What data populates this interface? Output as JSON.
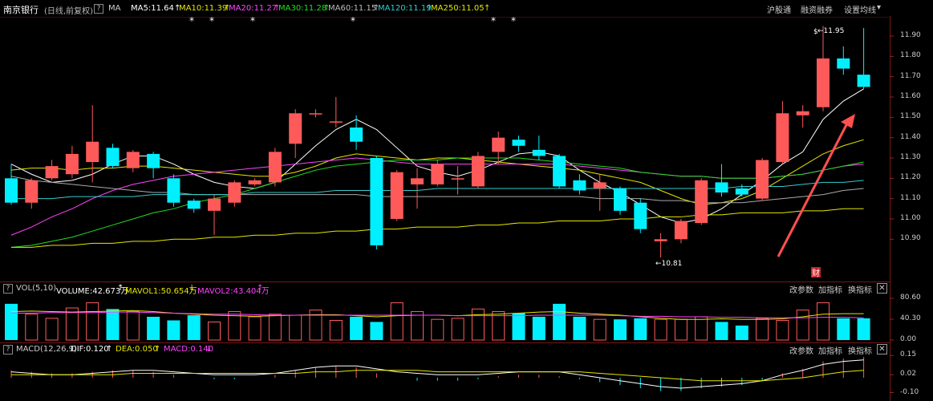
{
  "header": {
    "stock_name": "南京银行",
    "period": "(日线,前复权)",
    "help": "?",
    "indicator": "MA",
    "ma_items": [
      {
        "label": "MA5:11.64",
        "color": "#ffffff"
      },
      {
        "label": "MA10:11.39",
        "color": "#e6e600"
      },
      {
        "label": "MA20:11.27",
        "color": "#ff44ff"
      },
      {
        "label": "MA30:11.28",
        "color": "#22dd22"
      },
      {
        "label": "MA60:11.15",
        "color": "#bbbbbb"
      },
      {
        "label": "MA120:11.19",
        "color": "#33cccc"
      },
      {
        "label": "MA250:11.05",
        "color": "#e6e600"
      }
    ],
    "up_arrow": "↑",
    "menu": {
      "hgt": "沪股通",
      "margin": "融资融券",
      "settings": "设置均线",
      "settings_arrow": "▾"
    }
  },
  "price_axis": [
    "11.90",
    "11.80",
    "11.70",
    "11.60",
    "11.50",
    "11.40",
    "11.30",
    "11.20",
    "11.10",
    "11.00",
    "10.90"
  ],
  "annotations": {
    "high": "11.95",
    "low": "10.81",
    "fin_badge": "财",
    "marker": "*",
    "top_marker": "$"
  },
  "volume_panel": {
    "help": "?",
    "name": "VOL(5,10)",
    "volume": "VOLUME:42.673万",
    "mavol1": "MAVOL1:50.654万",
    "mavol2": "MAVOL2:43.404万",
    "arrow_up": "↑",
    "arrow_down": "↓",
    "change_params": "改参数",
    "add_indicator": "加指标",
    "switch_indicator": "换指标",
    "close": "✕",
    "axis": [
      "80.60",
      "40.30",
      "0.00"
    ]
  },
  "macd_panel": {
    "help": "?",
    "name": "MACD(12,26,9)",
    "dif": "DIF:0.120",
    "dea": "DEA:0.050",
    "macd": "MACD:0.140",
    "arrow_up": "↑",
    "arrow_down": "↓",
    "change_params": "改参数",
    "add_indicator": "加指标",
    "switch_indicator": "换指标",
    "close": "✕",
    "axis": [
      "0.15",
      "0.02",
      "-0.10"
    ]
  },
  "colors": {
    "up": "#ff5a5a",
    "down": "#00f0ff",
    "accent_arrow": "#ff5050"
  },
  "chart_data": {
    "type": "candlestick",
    "candles": [
      {
        "o": 11.2,
        "c": 11.08,
        "h": 11.27,
        "l": 11.07
      },
      {
        "o": 11.08,
        "c": 11.19,
        "h": 11.2,
        "l": 11.05
      },
      {
        "o": 11.2,
        "c": 11.26,
        "h": 11.29,
        "l": 11.19
      },
      {
        "o": 11.22,
        "c": 11.32,
        "h": 11.36,
        "l": 11.2
      },
      {
        "o": 11.28,
        "c": 11.38,
        "h": 11.56,
        "l": 11.18
      },
      {
        "o": 11.35,
        "c": 11.26,
        "h": 11.37,
        "l": 11.25
      },
      {
        "o": 11.25,
        "c": 11.33,
        "h": 11.34,
        "l": 11.23
      },
      {
        "o": 11.32,
        "c": 11.25,
        "h": 11.33,
        "l": 11.2
      },
      {
        "o": 11.2,
        "c": 11.08,
        "h": 11.22,
        "l": 11.06
      },
      {
        "o": 11.09,
        "c": 11.05,
        "h": 11.1,
        "l": 11.03
      },
      {
        "o": 11.04,
        "c": 11.1,
        "h": 11.12,
        "l": 10.92
      },
      {
        "o": 11.08,
        "c": 11.18,
        "h": 11.19,
        "l": 11.06
      },
      {
        "o": 11.17,
        "c": 11.19,
        "h": 11.2,
        "l": 11.16
      },
      {
        "o": 11.18,
        "c": 11.33,
        "h": 11.35,
        "l": 11.16
      },
      {
        "o": 11.37,
        "c": 11.52,
        "h": 11.54,
        "l": 11.3
      },
      {
        "o": 11.52,
        "c": 11.52,
        "h": 11.54,
        "l": 11.5
      },
      {
        "o": 11.48,
        "c": 11.48,
        "h": 11.6,
        "l": 11.45
      },
      {
        "o": 11.45,
        "c": 11.38,
        "h": 11.51,
        "l": 11.34
      },
      {
        "o": 11.3,
        "c": 10.87,
        "h": 11.31,
        "l": 10.85
      },
      {
        "o": 11.0,
        "c": 11.23,
        "h": 11.24,
        "l": 10.99
      },
      {
        "o": 11.17,
        "c": 11.2,
        "h": 11.25,
        "l": 11.05
      },
      {
        "o": 11.17,
        "c": 11.27,
        "h": 11.29,
        "l": 11.16
      },
      {
        "o": 11.2,
        "c": 11.2,
        "h": 11.26,
        "l": 11.12
      },
      {
        "o": 11.16,
        "c": 11.31,
        "h": 11.33,
        "l": 11.15
      },
      {
        "o": 11.33,
        "c": 11.4,
        "h": 11.43,
        "l": 11.27
      },
      {
        "o": 11.39,
        "c": 11.36,
        "h": 11.41,
        "l": 11.33
      },
      {
        "o": 11.34,
        "c": 11.31,
        "h": 11.41,
        "l": 11.29
      },
      {
        "o": 11.31,
        "c": 11.16,
        "h": 11.32,
        "l": 11.15
      },
      {
        "o": 11.19,
        "c": 11.14,
        "h": 11.22,
        "l": 11.12
      },
      {
        "o": 11.15,
        "c": 11.18,
        "h": 11.22,
        "l": 11.04
      },
      {
        "o": 11.15,
        "c": 11.04,
        "h": 11.16,
        "l": 11.02
      },
      {
        "o": 11.08,
        "c": 10.95,
        "h": 11.1,
        "l": 10.93
      },
      {
        "o": 10.89,
        "c": 10.9,
        "h": 10.93,
        "l": 10.81
      },
      {
        "o": 10.9,
        "c": 10.99,
        "h": 11.0,
        "l": 10.88
      },
      {
        "o": 10.98,
        "c": 11.19,
        "h": 11.2,
        "l": 10.97
      },
      {
        "o": 11.18,
        "c": 11.13,
        "h": 11.27,
        "l": 11.11
      },
      {
        "o": 11.15,
        "c": 11.12,
        "h": 11.17,
        "l": 11.11
      },
      {
        "o": 11.1,
        "c": 11.29,
        "h": 11.3,
        "l": 11.09
      },
      {
        "o": 11.28,
        "c": 11.52,
        "h": 11.58,
        "l": 11.27
      },
      {
        "o": 11.51,
        "c": 11.53,
        "h": 11.56,
        "l": 11.45
      },
      {
        "o": 11.55,
        "c": 11.79,
        "h": 11.95,
        "l": 11.53
      },
      {
        "o": 11.79,
        "c": 11.74,
        "h": 11.85,
        "l": 11.71
      },
      {
        "o": 11.71,
        "c": 11.65,
        "h": 11.94,
        "l": 11.64
      }
    ],
    "ma": {
      "MA5": [
        11.27,
        11.22,
        11.18,
        11.19,
        11.22,
        11.27,
        11.31,
        11.31,
        11.27,
        11.22,
        11.18,
        11.16,
        11.15,
        11.18,
        11.27,
        11.36,
        11.44,
        11.49,
        11.44,
        11.35,
        11.26,
        11.23,
        11.21,
        11.24,
        11.28,
        11.32,
        11.33,
        11.31,
        11.24,
        11.18,
        11.13,
        11.07,
        11.01,
        10.98,
        11.0,
        11.05,
        11.12,
        11.19,
        11.27,
        11.33,
        11.49,
        11.58,
        11.64
      ],
      "MA10": [
        11.24,
        11.25,
        11.25,
        11.24,
        11.25,
        11.25,
        11.26,
        11.26,
        11.25,
        11.24,
        11.23,
        11.22,
        11.21,
        11.21,
        11.23,
        11.26,
        11.3,
        11.32,
        11.31,
        11.3,
        11.29,
        11.3,
        11.3,
        11.29,
        11.28,
        11.27,
        11.26,
        11.25,
        11.24,
        11.22,
        11.2,
        11.18,
        11.14,
        11.1,
        11.07,
        11.08,
        11.1,
        11.14,
        11.2,
        11.26,
        11.32,
        11.36,
        11.39
      ],
      "MA20": [
        10.92,
        10.96,
        11.01,
        11.05,
        11.1,
        11.14,
        11.17,
        11.19,
        11.21,
        11.22,
        11.23,
        11.24,
        11.25,
        11.26,
        11.27,
        11.28,
        11.29,
        11.3,
        11.29,
        11.28,
        11.27,
        11.27,
        11.27,
        11.27,
        11.27,
        11.27,
        11.27,
        11.27,
        11.26,
        11.25,
        11.24,
        11.23,
        11.22,
        11.21,
        11.21,
        11.2,
        11.2,
        11.2,
        11.21,
        11.22,
        11.24,
        11.26,
        11.27
      ],
      "MA30": [
        10.86,
        10.87,
        10.89,
        10.91,
        10.94,
        10.97,
        11.0,
        11.03,
        11.05,
        11.08,
        11.1,
        11.12,
        11.15,
        11.18,
        11.21,
        11.24,
        11.26,
        11.27,
        11.28,
        11.29,
        11.29,
        11.29,
        11.3,
        11.3,
        11.3,
        11.3,
        11.29,
        11.28,
        11.27,
        11.26,
        11.25,
        11.23,
        11.22,
        11.21,
        11.21,
        11.2,
        11.2,
        11.2,
        11.21,
        11.22,
        11.24,
        11.26,
        11.28
      ],
      "MA60": [
        11.21,
        11.19,
        11.18,
        11.17,
        11.16,
        11.15,
        11.14,
        11.13,
        11.13,
        11.12,
        11.12,
        11.12,
        11.12,
        11.12,
        11.12,
        11.12,
        11.12,
        11.12,
        11.11,
        11.11,
        11.11,
        11.11,
        11.11,
        11.11,
        11.11,
        11.11,
        11.11,
        11.11,
        11.11,
        11.1,
        11.1,
        11.1,
        11.09,
        11.09,
        11.08,
        11.08,
        11.08,
        11.09,
        11.1,
        11.11,
        11.12,
        11.14,
        11.15
      ],
      "MA120": [
        11.1,
        11.1,
        11.1,
        11.11,
        11.11,
        11.11,
        11.11,
        11.12,
        11.12,
        11.12,
        11.12,
        11.12,
        11.13,
        11.13,
        11.13,
        11.13,
        11.14,
        11.14,
        11.14,
        11.14,
        11.14,
        11.15,
        11.15,
        11.15,
        11.15,
        11.15,
        11.15,
        11.15,
        11.15,
        11.15,
        11.15,
        11.15,
        11.15,
        11.15,
        11.15,
        11.15,
        11.16,
        11.16,
        11.16,
        11.17,
        11.18,
        11.18,
        11.19
      ],
      "MA250": [
        10.86,
        10.86,
        10.87,
        10.87,
        10.88,
        10.88,
        10.89,
        10.89,
        10.9,
        10.9,
        10.91,
        10.91,
        10.92,
        10.92,
        10.93,
        10.93,
        10.94,
        10.94,
        10.95,
        10.95,
        10.96,
        10.96,
        10.96,
        10.97,
        10.97,
        10.98,
        10.98,
        10.99,
        10.99,
        10.99,
        11.0,
        11.0,
        11.01,
        11.01,
        11.02,
        11.02,
        11.03,
        11.03,
        11.03,
        11.04,
        11.04,
        11.05,
        11.05
      ]
    },
    "volume": [
      70,
      50,
      42,
      62,
      72,
      60,
      55,
      45,
      38,
      48,
      35,
      55,
      45,
      50,
      48,
      58,
      38,
      45,
      35,
      72,
      55,
      40,
      42,
      60,
      55,
      52,
      45,
      70,
      45,
      40,
      40,
      42,
      40,
      40,
      45,
      35,
      28,
      42,
      38,
      58,
      72,
      42,
      42
    ],
    "mavol1": [
      55,
      56,
      55,
      54,
      55,
      56,
      57,
      55,
      52,
      50,
      48,
      47,
      46,
      47,
      48,
      49,
      49,
      47,
      45,
      47,
      48,
      48,
      47,
      49,
      50,
      52,
      54,
      55,
      52,
      50,
      48,
      45,
      42,
      40,
      40,
      41,
      40,
      40,
      41,
      45,
      50,
      51,
      51
    ],
    "mavol2": [
      52,
      52,
      53,
      53,
      53,
      54,
      54,
      53,
      52,
      51,
      50,
      50,
      49,
      48,
      48,
      48,
      48,
      48,
      48,
      48,
      48,
      48,
      47,
      47,
      47,
      47,
      48,
      48,
      48,
      48,
      47,
      46,
      46,
      45,
      45,
      44,
      44,
      43,
      43,
      43,
      44,
      44,
      43
    ],
    "macd_hist": [
      0.05,
      0.04,
      0.03,
      0.03,
      0.04,
      0.05,
      0.05,
      0.04,
      0.02,
      0.0,
      -0.01,
      -0.01,
      0.0,
      0.02,
      0.05,
      0.07,
      0.08,
      0.07,
      0.03,
      0.0,
      -0.02,
      -0.02,
      -0.02,
      -0.01,
      0.01,
      0.02,
      0.02,
      0.01,
      -0.01,
      -0.03,
      -0.05,
      -0.07,
      -0.09,
      -0.09,
      -0.07,
      -0.06,
      -0.05,
      -0.02,
      0.03,
      0.06,
      0.11,
      0.13,
      0.14
    ],
    "dif": [
      0.04,
      0.03,
      0.02,
      0.02,
      0.03,
      0.04,
      0.05,
      0.05,
      0.04,
      0.03,
      0.02,
      0.02,
      0.02,
      0.03,
      0.05,
      0.07,
      0.08,
      0.08,
      0.06,
      0.04,
      0.03,
      0.02,
      0.02,
      0.02,
      0.03,
      0.04,
      0.04,
      0.04,
      0.02,
      0.0,
      -0.02,
      -0.04,
      -0.06,
      -0.07,
      -0.06,
      -0.05,
      -0.04,
      -0.02,
      0.02,
      0.05,
      0.09,
      0.11,
      0.12
    ],
    "dea": [
      0.02,
      0.02,
      0.02,
      0.02,
      0.02,
      0.02,
      0.03,
      0.03,
      0.03,
      0.03,
      0.03,
      0.03,
      0.03,
      0.03,
      0.03,
      0.04,
      0.04,
      0.05,
      0.05,
      0.05,
      0.05,
      0.04,
      0.04,
      0.04,
      0.04,
      0.04,
      0.04,
      0.04,
      0.04,
      0.03,
      0.02,
      0.01,
      0.0,
      -0.01,
      -0.02,
      -0.02,
      -0.02,
      -0.02,
      -0.01,
      0.0,
      0.02,
      0.04,
      0.05
    ]
  }
}
